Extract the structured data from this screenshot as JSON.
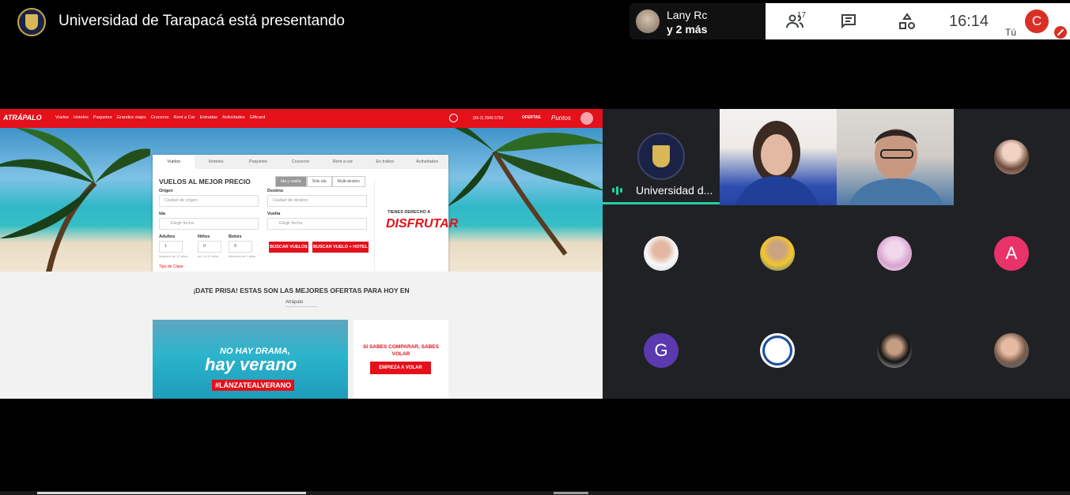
{
  "meeting": {
    "presenter_title": "Universidad de Tarapacá está presentando",
    "viewers": {
      "name": "Lany Rc",
      "more": "y 2 más"
    },
    "participant_count": "17",
    "clock": "16:14",
    "self_label": "Tú",
    "self_initial": "C"
  },
  "site": {
    "logo": "ATRÁPALO",
    "nav": [
      "Vuelos",
      "Hoteles",
      "Paquetes",
      "Grandes viajes",
      "Cruceros",
      "Rent a Car",
      "Entradas",
      "Actividades",
      "Giftcard"
    ],
    "phone": "(56-2) 2945 5750",
    "offers": "OFERTAS",
    "puntos": "Puntos",
    "tabs": [
      "Vuelos",
      "Hoteles",
      "Paquetes",
      "Cruceros",
      "Rent a car",
      "En trailes",
      "Actividades"
    ],
    "heading": "VUELOS AL MEJOR PRECIO",
    "trip_types": [
      "Ida y vuelta",
      "Sólo ida",
      "Multi-destino"
    ],
    "origin_label": "Origen",
    "origin_placeholder": "Ciudad de origen",
    "dest_label": "Destino",
    "dest_placeholder": "Ciudad de destino",
    "ida_label": "Ida",
    "ida_placeholder": "Elegir fecha",
    "vuelta_label": "Vuelta",
    "vuelta_placeholder": "Elegir fecha",
    "adults_label": "Adultos",
    "adults_value": "1",
    "adults_hint": "Mayores de 12 años",
    "kids_label": "Niños",
    "kids_value": "0",
    "kids_hint": "de 2 a 11 años",
    "babies_label": "Bebés",
    "babies_value": "0",
    "babies_hint": "Menores de 2 años",
    "search_flights": "BUSCAR VUELOS",
    "search_flight_hotel": "BUSCAR VUELO + HOTEL",
    "class_link": "Tipo de Clase",
    "promo_small": "TIENES DERECHO A",
    "promo_big": "DISFRUTAR",
    "deals_title": "¡DATE PRISA! ESTAS SON LAS MEJORES OFERTAS PARA HOY EN",
    "deals_select": "Atrápalo",
    "banner_line1": "NO HAY DRAMA,",
    "banner_line2": "hay verano",
    "banner_tag": "#LÁNZATEALVERANO",
    "banner_right_text": "SI SABES COMPARAR, SABES VOLAR",
    "banner_right_button": "EMPIEZA A VOLAR"
  },
  "grid": {
    "uni_label": "Universidad d...",
    "letters": {
      "a": "A",
      "g": "G"
    }
  },
  "colors": {
    "brand_red": "#e4101a",
    "speaking": "#1fd1a6",
    "self_avatar": "#d93025"
  }
}
